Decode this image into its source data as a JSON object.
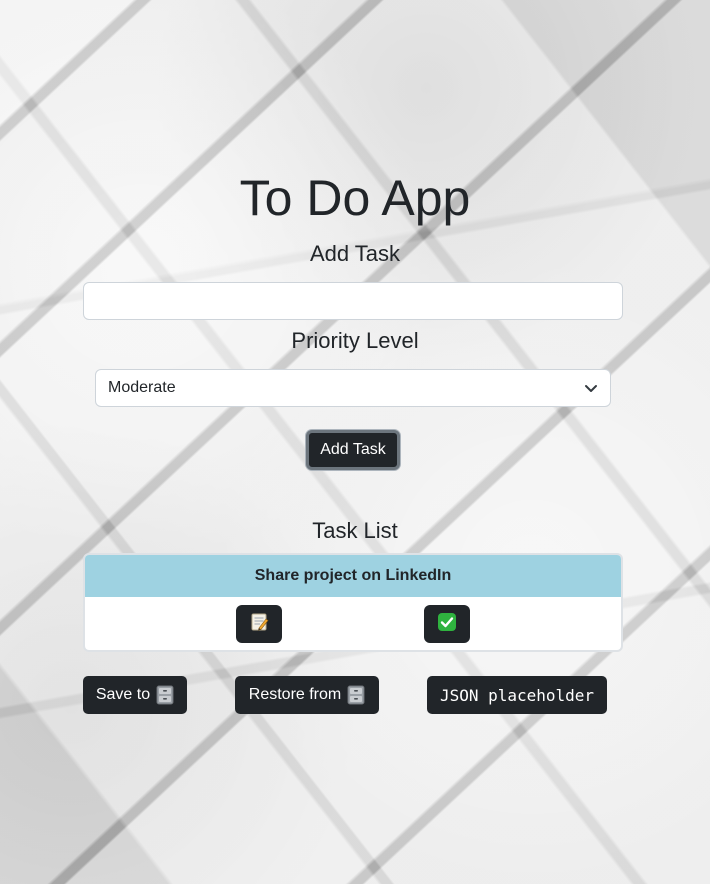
{
  "app": {
    "title": "To Do App"
  },
  "add_task": {
    "label": "Add Task",
    "input_value": "",
    "input_placeholder": "",
    "button_label": "Add Task"
  },
  "priority": {
    "label": "Priority Level",
    "selected": "Moderate"
  },
  "task_list": {
    "label": "Task List",
    "tasks": [
      {
        "text": "Share project on LinkedIn",
        "header_color": "#9ed2e1",
        "edit_icon": "memo-icon",
        "complete_icon": "check-mark-button-icon"
      }
    ]
  },
  "footer": {
    "save_label": "Save to",
    "restore_label": "Restore from",
    "json_label": "JSON placeholder",
    "storage_icon": "file-cabinet-icon"
  },
  "colors": {
    "button_dark": "#212529",
    "task_header": "#9ed2e1"
  }
}
